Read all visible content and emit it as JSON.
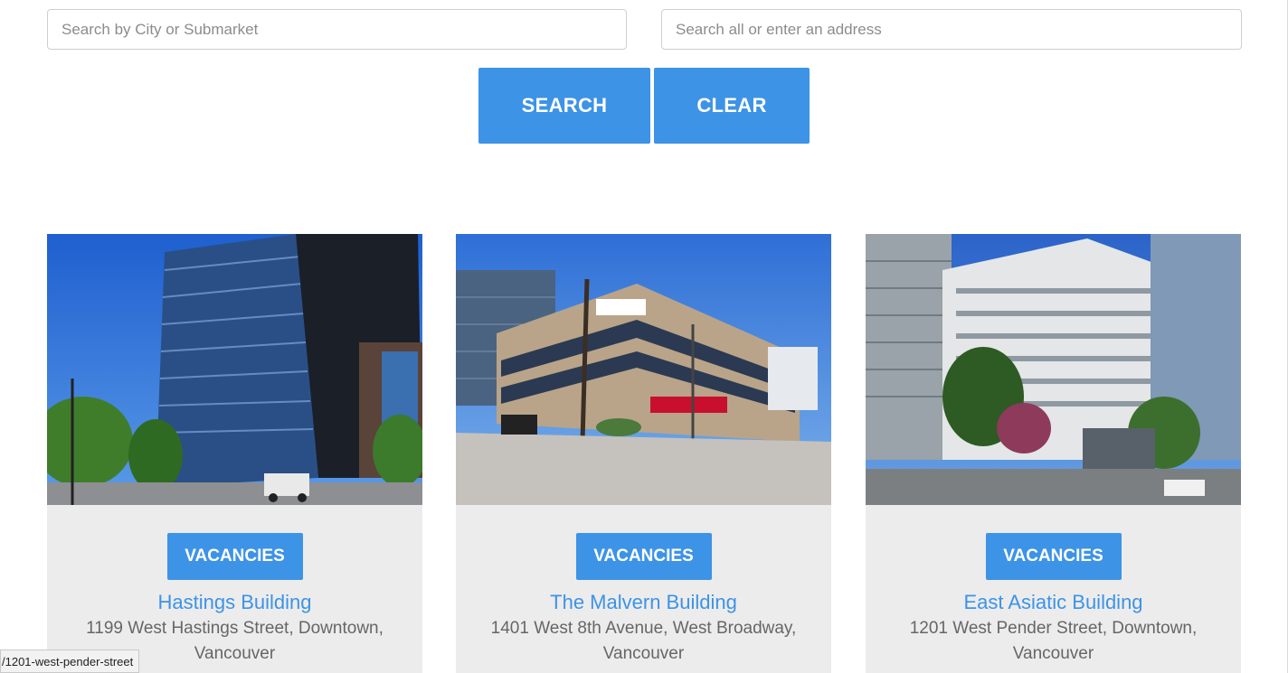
{
  "search": {
    "city_placeholder": "Search by City or Submarket",
    "address_placeholder": "Search all or enter an address",
    "search_label": "SEARCH",
    "clear_label": "CLEAR"
  },
  "cards": [
    {
      "vacancies_label": "VACANCIES",
      "title": "Hastings Building",
      "address": "1199 West Hastings Street, Downtown, Vancouver"
    },
    {
      "vacancies_label": "VACANCIES",
      "title": "The Malvern Building",
      "address": "1401 West 8th Avenue, West Broadway, Vancouver"
    },
    {
      "vacancies_label": "VACANCIES",
      "title": "East Asiatic Building",
      "address": "1201 West Pender Street, Downtown, Vancouver"
    }
  ],
  "status_bar": {
    "url": "/1201-west-pender-street"
  },
  "colors": {
    "accent": "#3d93e6",
    "card_bg": "#ececec",
    "address_text": "#666666"
  }
}
